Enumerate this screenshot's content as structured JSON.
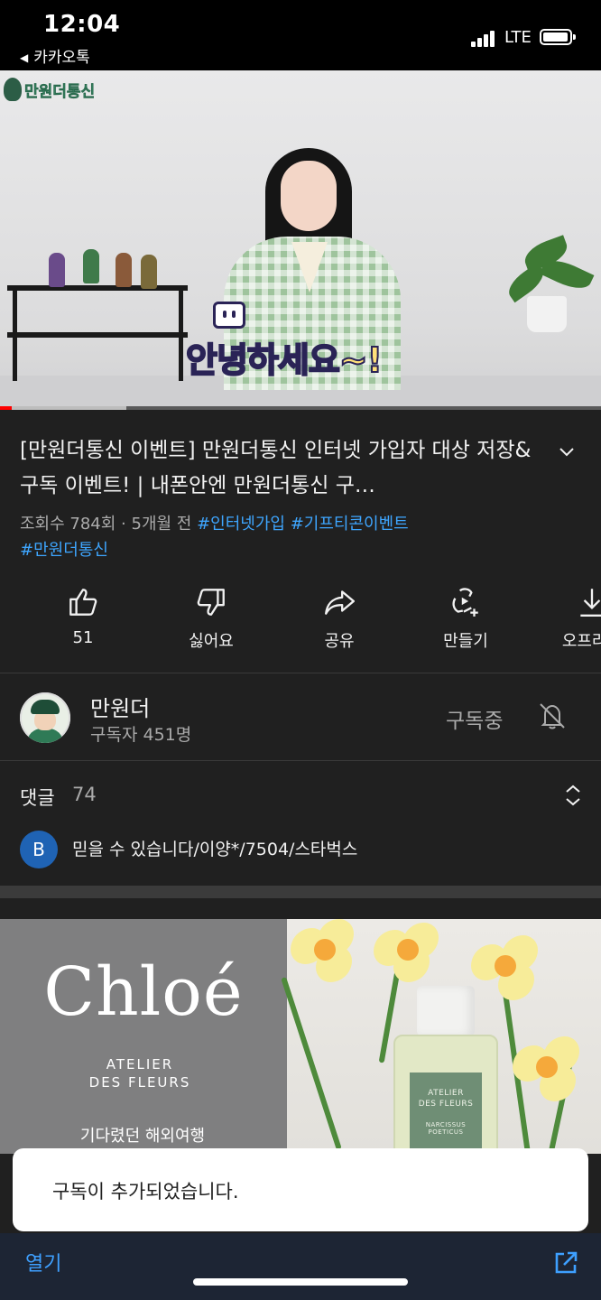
{
  "status_bar": {
    "time": "12:04",
    "back_app": "카카오톡",
    "network": "LTE",
    "battery_level": 0.95
  },
  "video": {
    "channel_watermark": "만원더통신",
    "subtitle": "안녕하세요~!",
    "progress": {
      "played_fraction": 0.02,
      "buffered_fraction": 0.21
    }
  },
  "title": "[만원더통신 이벤트] 만원더통신 인터넷 가입자 대상 저장&구독 이벤트! | 내폰안엔 만원더통신 구…",
  "meta": {
    "views": "조회수 784회",
    "separator": " · ",
    "age": "5개월 전",
    "tags": [
      "#인터넷가입",
      "#기프티콘이벤트",
      "#만원더통신"
    ]
  },
  "actions": [
    {
      "icon": "thumbs-up-icon",
      "label": "51"
    },
    {
      "icon": "thumbs-down-icon",
      "label": "싫어요"
    },
    {
      "icon": "share-icon",
      "label": "공유"
    },
    {
      "icon": "remix-icon",
      "label": "만들기"
    },
    {
      "icon": "download-icon",
      "label": "오프라인"
    }
  ],
  "channel": {
    "name": "만원더",
    "subscribers": "구독자 451명",
    "subscribe_state": "구독중"
  },
  "comments": {
    "heading": "댓글",
    "count": "74",
    "top_comment": {
      "avatar_letter": "B",
      "text": "믿을 수 있습니다/이양*/7504/스타벅스"
    }
  },
  "ad": {
    "brand": "Chloé",
    "line1": "ATELIER",
    "line2": "DES FLEURS",
    "korean_text": "기다렸던 해외여행",
    "bottle_line1": "ATELIER",
    "bottle_line2": "DES FLEURS",
    "bottle_line3": "NARCISSUS POETICUS"
  },
  "toast": {
    "message": "구독이 추가되었습니다."
  },
  "bottom_bar": {
    "open_label": "열기",
    "external_icon": "open-external-icon"
  },
  "colors": {
    "background": "#202020",
    "accent_link": "#3ea6ff",
    "progress": "#ff0000",
    "bottom_bar": "#1d2534"
  }
}
